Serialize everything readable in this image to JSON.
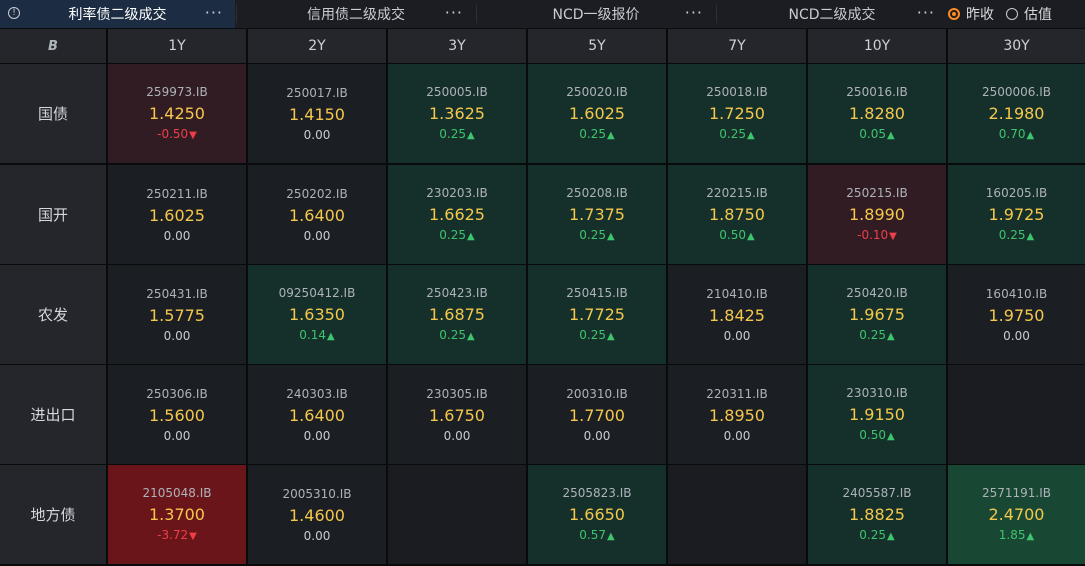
{
  "tabs": [
    {
      "label": "利率债二级成交",
      "active": true
    },
    {
      "label": "信用债二级成交",
      "active": false
    },
    {
      "label": "NCD一级报价",
      "active": false
    },
    {
      "label": "NCD二级成交",
      "active": false
    }
  ],
  "more_label": "···",
  "radios": [
    {
      "label": "昨收",
      "checked": true
    },
    {
      "label": "估值",
      "checked": false
    }
  ],
  "columns": [
    "1Y",
    "2Y",
    "3Y",
    "5Y",
    "7Y",
    "10Y",
    "30Y"
  ],
  "corner_icon": "B",
  "colors": {
    "up": "#3ec46d",
    "down": "#ef3e48",
    "rate": "#f5c84c",
    "active_tab": "#1c2c42",
    "radio_on": "#ff8a1f"
  },
  "rows": [
    {
      "label": "国债",
      "cells": [
        {
          "code": "259973.IB",
          "rate": "1.4250",
          "change": "-0.50",
          "dir": "down",
          "tone": "r"
        },
        {
          "code": "250017.IB",
          "rate": "1.4150",
          "change": "0.00",
          "dir": "flat",
          "tone": "n"
        },
        {
          "code": "250005.IB",
          "rate": "1.3625",
          "change": "0.25",
          "dir": "up",
          "tone": "g"
        },
        {
          "code": "250020.IB",
          "rate": "1.6025",
          "change": "0.25",
          "dir": "up",
          "tone": "g"
        },
        {
          "code": "250018.IB",
          "rate": "1.7250",
          "change": "0.25",
          "dir": "up",
          "tone": "g"
        },
        {
          "code": "250016.IB",
          "rate": "1.8280",
          "change": "0.05",
          "dir": "up",
          "tone": "g"
        },
        {
          "code": "2500006.IB",
          "rate": "2.1980",
          "change": "0.70",
          "dir": "up",
          "tone": "g"
        }
      ]
    },
    {
      "label": "国开",
      "cells": [
        {
          "code": "250211.IB",
          "rate": "1.6025",
          "change": "0.00",
          "dir": "flat",
          "tone": "n"
        },
        {
          "code": "250202.IB",
          "rate": "1.6400",
          "change": "0.00",
          "dir": "flat",
          "tone": "n"
        },
        {
          "code": "230203.IB",
          "rate": "1.6625",
          "change": "0.25",
          "dir": "up",
          "tone": "g"
        },
        {
          "code": "250208.IB",
          "rate": "1.7375",
          "change": "0.25",
          "dir": "up",
          "tone": "g"
        },
        {
          "code": "220215.IB",
          "rate": "1.8750",
          "change": "0.50",
          "dir": "up",
          "tone": "g"
        },
        {
          "code": "250215.IB",
          "rate": "1.8990",
          "change": "-0.10",
          "dir": "down",
          "tone": "r"
        },
        {
          "code": "160205.IB",
          "rate": "1.9725",
          "change": "0.25",
          "dir": "up",
          "tone": "g"
        }
      ]
    },
    {
      "label": "农发",
      "cells": [
        {
          "code": "250431.IB",
          "rate": "1.5775",
          "change": "0.00",
          "dir": "flat",
          "tone": "n"
        },
        {
          "code": "09250412.IB",
          "rate": "1.6350",
          "change": "0.14",
          "dir": "up",
          "tone": "g"
        },
        {
          "code": "250423.IB",
          "rate": "1.6875",
          "change": "0.25",
          "dir": "up",
          "tone": "g"
        },
        {
          "code": "250415.IB",
          "rate": "1.7725",
          "change": "0.25",
          "dir": "up",
          "tone": "g"
        },
        {
          "code": "210410.IB",
          "rate": "1.8425",
          "change": "0.00",
          "dir": "flat",
          "tone": "n"
        },
        {
          "code": "250420.IB",
          "rate": "1.9675",
          "change": "0.25",
          "dir": "up",
          "tone": "g"
        },
        {
          "code": "160410.IB",
          "rate": "1.9750",
          "change": "0.00",
          "dir": "flat",
          "tone": "n"
        }
      ]
    },
    {
      "label": "进出口",
      "cells": [
        {
          "code": "250306.IB",
          "rate": "1.5600",
          "change": "0.00",
          "dir": "flat",
          "tone": "n"
        },
        {
          "code": "240303.IB",
          "rate": "1.6400",
          "change": "0.00",
          "dir": "flat",
          "tone": "n"
        },
        {
          "code": "230305.IB",
          "rate": "1.6750",
          "change": "0.00",
          "dir": "flat",
          "tone": "n"
        },
        {
          "code": "200310.IB",
          "rate": "1.7700",
          "change": "0.00",
          "dir": "flat",
          "tone": "n"
        },
        {
          "code": "220311.IB",
          "rate": "1.8950",
          "change": "0.00",
          "dir": "flat",
          "tone": "n"
        },
        {
          "code": "230310.IB",
          "rate": "1.9150",
          "change": "0.50",
          "dir": "up",
          "tone": "g"
        },
        null
      ]
    },
    {
      "label": "地方债",
      "cells": [
        {
          "code": "2105048.IB",
          "rate": "1.3700",
          "change": "-3.72",
          "dir": "down",
          "tone": "r2"
        },
        {
          "code": "2005310.IB",
          "rate": "1.4600",
          "change": "0.00",
          "dir": "flat",
          "tone": "n"
        },
        null,
        {
          "code": "2505823.IB",
          "rate": "1.6650",
          "change": "0.57",
          "dir": "up",
          "tone": "g"
        },
        null,
        {
          "code": "2405587.IB",
          "rate": "1.8825",
          "change": "0.25",
          "dir": "up",
          "tone": "g"
        },
        {
          "code": "2571191.IB",
          "rate": "2.4700",
          "change": "1.85",
          "dir": "up",
          "tone": "g2"
        }
      ]
    }
  ]
}
